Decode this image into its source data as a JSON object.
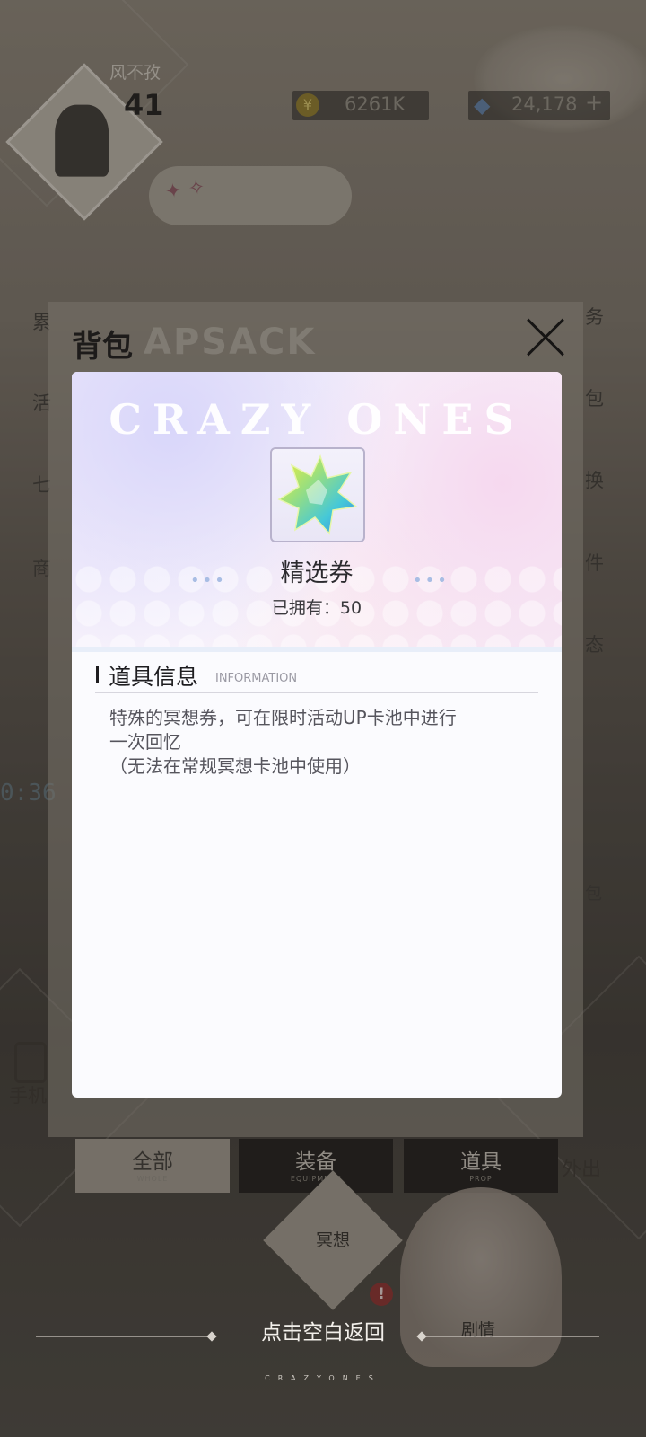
{
  "hud": {
    "player_name": "风不孜",
    "level": "41",
    "coins": "6261K",
    "gems": "24,178",
    "gems_plus": "+"
  },
  "background": {
    "side_labels_left": [
      "累",
      "活",
      "七",
      "商"
    ],
    "side_labels_right": [
      "务",
      "包",
      "换",
      "件",
      "态",
      "包"
    ],
    "timer_text": "0:36",
    "phone_label": "手机",
    "outing_label": "外出",
    "tabs": [
      {
        "label": "全部",
        "sub": "WHOLE"
      },
      {
        "label": "装备",
        "sub": "EQUIPMENT"
      },
      {
        "label": "道具",
        "sub": "PROP"
      }
    ],
    "meditate_label": "冥想",
    "story_label": "剧情",
    "badge": "!"
  },
  "backpack": {
    "title": "背包",
    "watermark": "APSACK"
  },
  "item": {
    "brand_text": "CRAZY ONES",
    "name": "精选券",
    "owned": "已拥有：50",
    "section_title": "道具信息",
    "section_sub": "INFORMATION",
    "description_lines": [
      "特殊的冥想券，可在限时活动UP卡池中进行",
      "一次回忆",
      "（无法在常规冥想卡池中使用）"
    ],
    "icon": "star-crystal-ticket-icon"
  },
  "footer": {
    "hint": "点击空白返回",
    "brand": "CRAZYONES"
  },
  "colors": {
    "card_bg": "#fbfbfe",
    "overlay": "#6a645d",
    "hint_text": "#f2efea"
  }
}
